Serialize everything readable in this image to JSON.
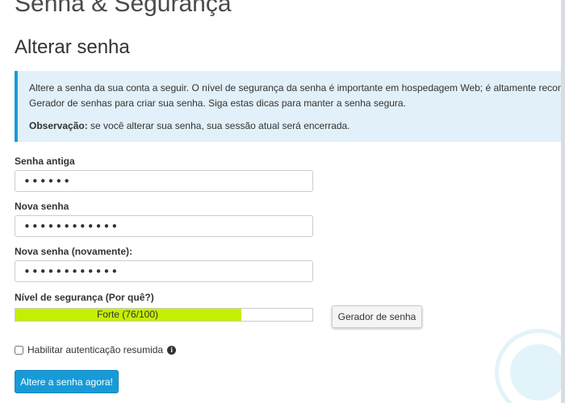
{
  "header": {
    "title": "Senha & Segurança"
  },
  "section": {
    "title": "Alterar senha"
  },
  "info": {
    "line1": "Altere a senha da sua conta a seguir. O nível de segurança da senha é importante em hospedagem Web; é altamente recomendável",
    "line2": "Gerador de senhas para criar sua senha. Siga estas dicas para manter a senha segura.",
    "note_label": "Observação:",
    "note_text": " se você alterar sua senha, sua sessão atual será encerrada."
  },
  "form": {
    "old_password": {
      "label": "Senha antiga",
      "value": "••••••"
    },
    "new_password": {
      "label": "Nova senha",
      "value": "••••••••••••"
    },
    "confirm_password": {
      "label": "Nova senha (novamente):",
      "value": "••••••••••••"
    },
    "strength": {
      "label": "Nível de segurança (Por quê?)",
      "text": "Forte (76/100)",
      "score": 76,
      "max": 100,
      "color": "#c5ef00"
    },
    "generator_button": "Gerador de senha",
    "digest_auth": {
      "label": "Habilitar autenticação resumida",
      "checked": false,
      "info_icon": "info-circle-icon"
    },
    "submit_button": "Altere a senha agora!"
  },
  "colors": {
    "accent": "#179bd7",
    "info_bg": "#e1f0f9"
  }
}
